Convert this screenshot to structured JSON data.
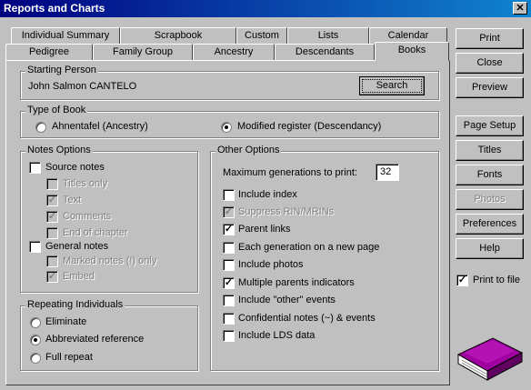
{
  "window": {
    "title": "Reports and Charts",
    "close_glyph": "✕"
  },
  "tabs": {
    "back_row": [
      "Individual Summary",
      "Scrapbook",
      "Custom",
      "Lists",
      "Calendar"
    ],
    "front_row": [
      "Pedigree",
      "Family Group",
      "Ancestry",
      "Descendants",
      "Books"
    ],
    "active": "Books"
  },
  "starting_person": {
    "legend": "Starting Person",
    "name": "John Salmon CANTELO",
    "search_label": "Search"
  },
  "book_type": {
    "legend": "Type of Book",
    "options": [
      {
        "label": "Ahnentafel (Ancestry)",
        "selected": false
      },
      {
        "label": "Modified register (Descendancy)",
        "selected": true
      }
    ]
  },
  "notes_options": {
    "legend": "Notes Options",
    "source_notes": {
      "label": "Source notes",
      "checked": false
    },
    "source_sub": [
      {
        "label": "Titles only",
        "checked": false
      },
      {
        "label": "Text",
        "checked": true
      },
      {
        "label": "Comments",
        "checked": true
      },
      {
        "label": "End of chapter",
        "checked": false
      }
    ],
    "general_notes": {
      "label": "General notes",
      "checked": false
    },
    "general_sub": [
      {
        "label": "Marked notes (!) only",
        "checked": false
      },
      {
        "label": "Embed",
        "checked": true
      }
    ]
  },
  "repeating": {
    "legend": "Repeating Individuals",
    "options": [
      {
        "label": "Eliminate",
        "selected": false
      },
      {
        "label": "Abbreviated reference",
        "selected": true
      },
      {
        "label": "Full repeat",
        "selected": false
      }
    ]
  },
  "other_options": {
    "legend": "Other Options",
    "max_gen_label": "Maximum generations to print:",
    "max_gen_value": "32",
    "items": [
      {
        "label": "Include index",
        "checked": false,
        "disabled": false
      },
      {
        "label": "Suppress RIN/MRINs",
        "checked": true,
        "disabled": true
      },
      {
        "label": "Parent links",
        "checked": true,
        "disabled": false
      },
      {
        "label": "Each generation on a new page",
        "checked": false,
        "disabled": false
      },
      {
        "label": "Include photos",
        "checked": false,
        "disabled": false
      },
      {
        "label": "Multiple parents indicators",
        "checked": true,
        "disabled": false
      },
      {
        "label": "Include \"other\" events",
        "checked": false,
        "disabled": false
      },
      {
        "label": "Confidential notes (~) & events",
        "checked": false,
        "disabled": false
      },
      {
        "label": "Include LDS data",
        "checked": false,
        "disabled": false
      }
    ]
  },
  "side_buttons": [
    {
      "label": "Print",
      "disabled": false
    },
    {
      "label": "Close",
      "disabled": false
    },
    {
      "label": "Preview",
      "disabled": false
    },
    {
      "label": "Page Setup",
      "disabled": false
    },
    {
      "label": "Titles",
      "disabled": false
    },
    {
      "label": "Fonts",
      "disabled": false
    },
    {
      "label": "Photos",
      "disabled": true
    },
    {
      "label": "Preferences",
      "disabled": false
    },
    {
      "label": "Help",
      "disabled": false
    }
  ],
  "print_to_file": {
    "label": "Print to file",
    "checked": true
  },
  "colors": {
    "book": "#800080",
    "title_bar": "#000080",
    "face": "#c0c0c0"
  },
  "icons": {
    "book": "book-icon",
    "check": "checkmark-icon"
  }
}
